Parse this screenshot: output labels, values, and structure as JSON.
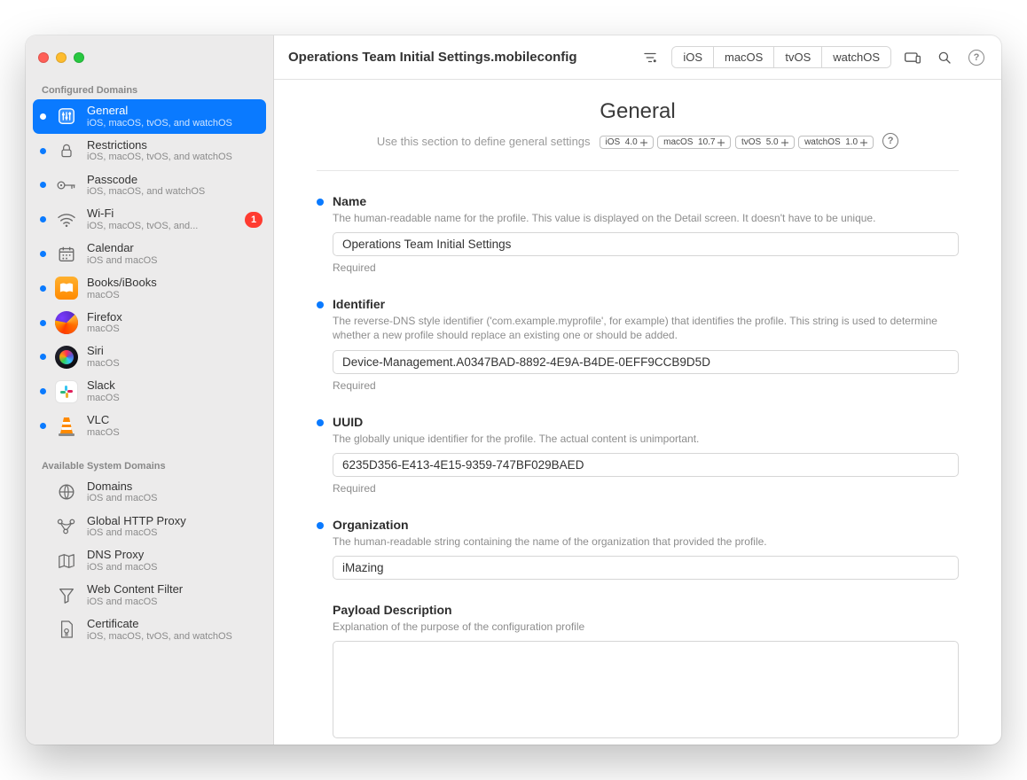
{
  "window": {
    "filename": "Operations Team Initial Settings.mobileconfig"
  },
  "toolbar": {
    "platforms": [
      "iOS",
      "macOS",
      "tvOS",
      "watchOS"
    ]
  },
  "sidebar": {
    "configured_header": "Configured Domains",
    "available_header": "Available System Domains",
    "configured": [
      {
        "title": "General",
        "sub": "iOS, macOS, tvOS, and watchOS",
        "icon": "sliders",
        "active": true,
        "dot": true
      },
      {
        "title": "Restrictions",
        "sub": "iOS, macOS, tvOS, and watchOS",
        "icon": "lock",
        "dot": true
      },
      {
        "title": "Passcode",
        "sub": "iOS, macOS, and watchOS",
        "icon": "key",
        "dot": true
      },
      {
        "title": "Wi-Fi",
        "sub": "iOS, macOS, tvOS, and...",
        "icon": "wifi",
        "dot": true,
        "badge": "1"
      },
      {
        "title": "Calendar",
        "sub": "iOS and macOS",
        "icon": "calendar",
        "dot": true
      },
      {
        "title": "Books/iBooks",
        "sub": "macOS",
        "icon": "books-app",
        "dot": true
      },
      {
        "title": "Firefox",
        "sub": "macOS",
        "icon": "firefox-app",
        "dot": true
      },
      {
        "title": "Siri",
        "sub": "macOS",
        "icon": "siri-app",
        "dot": true
      },
      {
        "title": "Slack",
        "sub": "macOS",
        "icon": "slack-app",
        "dot": true
      },
      {
        "title": "VLC",
        "sub": "macOS",
        "icon": "vlc-app",
        "dot": true
      }
    ],
    "available": [
      {
        "title": "Domains",
        "sub": "iOS and macOS",
        "icon": "globe"
      },
      {
        "title": "Global HTTP Proxy",
        "sub": "iOS and macOS",
        "icon": "proxy"
      },
      {
        "title": "DNS Proxy",
        "sub": "iOS and macOS",
        "icon": "map"
      },
      {
        "title": "Web Content Filter",
        "sub": "iOS and macOS",
        "icon": "funnel"
      },
      {
        "title": "Certificate",
        "sub": "iOS, macOS, tvOS, and watchOS",
        "icon": "cert"
      }
    ]
  },
  "page": {
    "title": "General",
    "subtitle": "Use this section to define general settings",
    "platform_chips": [
      {
        "label": "iOS",
        "ver": "4.0"
      },
      {
        "label": "macOS",
        "ver": "10.7"
      },
      {
        "label": "tvOS",
        "ver": "5.0"
      },
      {
        "label": "watchOS",
        "ver": "1.0"
      }
    ],
    "required_label": "Required",
    "fields": {
      "name": {
        "label": "Name",
        "desc": "The human-readable name for the profile. This value is displayed on the Detail screen. It doesn't have to be unique.",
        "value": "Operations Team Initial Settings",
        "required": true,
        "dot": true
      },
      "identifier": {
        "label": "Identifier",
        "desc": "The reverse-DNS style identifier ('com.example.myprofile', for example) that identifies the profile. This string is used to determine whether a new profile should replace an existing one or should be added.",
        "value": "Device-Management.A0347BAD-8892-4E9A-B4DE-0EFF9CCB9D5D",
        "required": true,
        "dot": true
      },
      "uuid": {
        "label": "UUID",
        "desc": "The globally unique identifier for the profile. The actual content is unimportant.",
        "value": "6235D356-E413-4E15-9359-747BF029BAED",
        "required": true,
        "dot": true
      },
      "organization": {
        "label": "Organization",
        "desc": "The human-readable string containing the name of the organization that provided the profile.",
        "value": "iMazing",
        "required": false,
        "dot": true
      },
      "payload_description": {
        "label": "Payload Description",
        "desc": "Explanation of the purpose of the configuration profile",
        "value": "",
        "required": false,
        "dot": false
      }
    }
  }
}
